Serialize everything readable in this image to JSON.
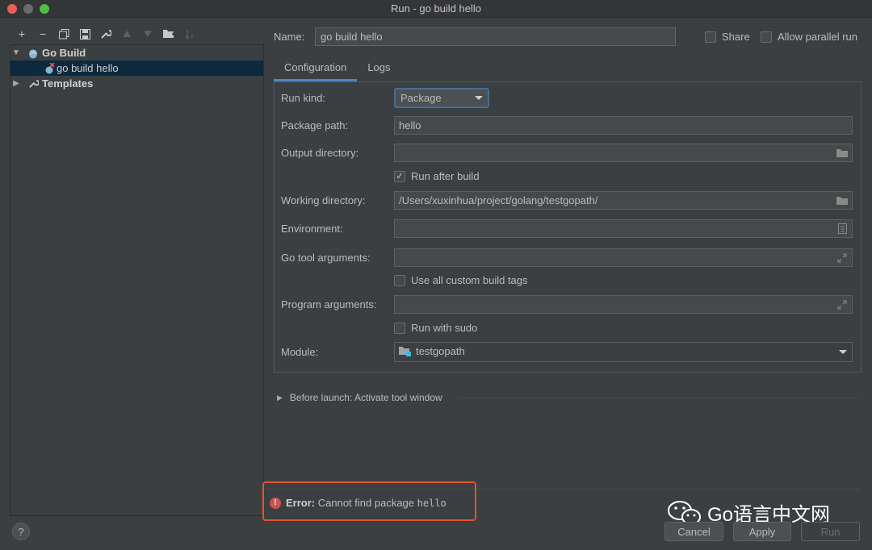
{
  "window": {
    "title": "Run - go build hello"
  },
  "toolbar": {
    "add": "+",
    "remove": "−",
    "copy": "⧉",
    "save": "▣",
    "edit": "🔧",
    "up": "▲",
    "down": "▼",
    "folder": "📁",
    "sort": "↓z"
  },
  "tree": {
    "group_label": "Go Build",
    "config_label": "go build hello",
    "templates_label": "Templates"
  },
  "form": {
    "name_label": "Name:",
    "name_value": "go build hello",
    "share_label": "Share",
    "parallel_label": "Allow parallel run",
    "tabs": [
      {
        "label": "Configuration"
      },
      {
        "label": "Logs"
      }
    ],
    "run_kind_label": "Run kind:",
    "run_kind_value": "Package",
    "package_path_label": "Package path:",
    "package_path_value": "hello",
    "output_dir_label": "Output directory:",
    "output_dir_value": "",
    "run_after_build_label": "Run after build",
    "working_dir_label": "Working directory:",
    "working_dir_value": "/Users/xuxinhua/project/golang/testgopath/",
    "environment_label": "Environment:",
    "environment_value": "",
    "go_tool_args_label": "Go tool arguments:",
    "go_tool_args_value": "",
    "custom_tags_label": "Use all custom build tags",
    "program_args_label": "Program arguments:",
    "program_args_value": "",
    "sudo_label": "Run with sudo",
    "module_label": "Module:",
    "module_value": "testgopath"
  },
  "before_launch": {
    "label": "Before launch: Activate tool window"
  },
  "error": {
    "prefix": "Error:",
    "message": "Cannot find package",
    "package": "hello"
  },
  "buttons": {
    "help": "?",
    "cancel": "Cancel",
    "apply": "Apply",
    "run": "Run"
  },
  "watermark": {
    "text": "Go语言中文网"
  },
  "colors": {
    "accent": "#4a88c7",
    "error": "#c75450",
    "highlight_border": "#e0542a",
    "selection": "#0d293e"
  }
}
